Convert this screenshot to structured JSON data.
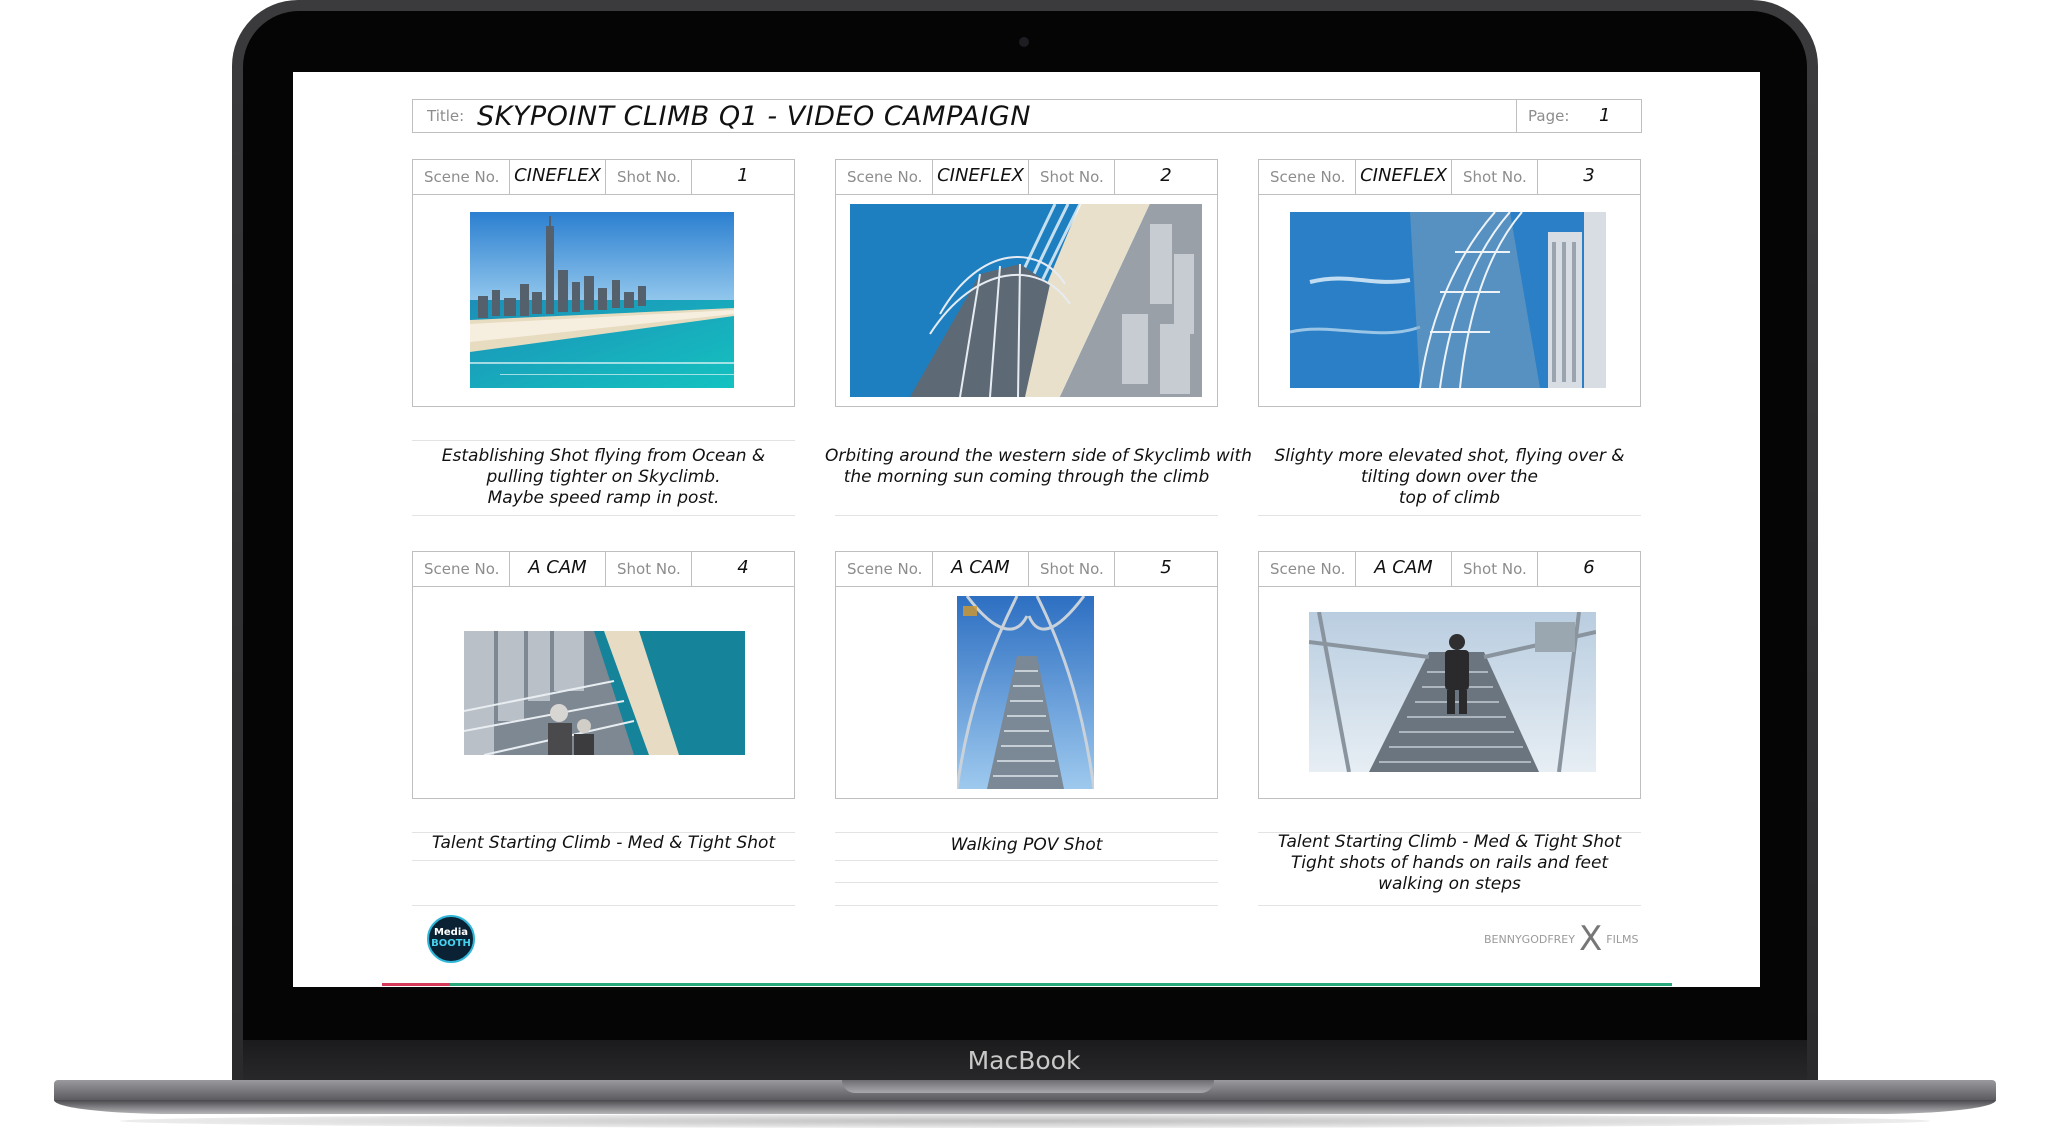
{
  "device": {
    "brand": "MacBook"
  },
  "storyboard": {
    "title_label": "Title:",
    "title": "SKYPOINT CLIMB Q1 - VIDEO CAMPAIGN",
    "page_label": "Page:",
    "page": "1"
  },
  "panels": [
    {
      "scene_label": "Scene No.",
      "scene": "CINEFLEX",
      "shot_label": "Shot No.",
      "shot": "1",
      "caption": [
        "Establishing Shot flying from Ocean &",
        "pulling tighter on Skyclimb.",
        "Maybe speed ramp in post."
      ]
    },
    {
      "scene_label": "Scene No.",
      "scene": "CINEFLEX",
      "shot_label": "Shot No.",
      "shot": "2",
      "caption": [
        "Orbiting around the western side of Skyclimb with",
        "the morning sun coming through the climb"
      ]
    },
    {
      "scene_label": "Scene No.",
      "scene": "CINEFLEX",
      "shot_label": "Shot No.",
      "shot": "3",
      "caption": [
        "Slighty more elevated shot, flying over &",
        "tilting down over the",
        "top of climb"
      ]
    },
    {
      "scene_label": "Scene No.",
      "scene": "A CAM",
      "shot_label": "Shot No.",
      "shot": "4",
      "caption": [
        "Talent Starting Climb -  Med & Tight Shot"
      ]
    },
    {
      "scene_label": "Scene No.",
      "scene": "A CAM",
      "shot_label": "Shot No.",
      "shot": "5",
      "caption": [
        "Walking POV Shot"
      ]
    },
    {
      "scene_label": "Scene No.",
      "scene": "A CAM",
      "shot_label": "Shot No.",
      "shot": "6",
      "caption": [
        "Talent Starting Climb -  Med & Tight Shot",
        "Tight shots of hands on rails and feet",
        "walking on steps"
      ]
    }
  ],
  "footer": {
    "left_logo": [
      "Media",
      "BOOTH"
    ],
    "right_logo": [
      "BENNYGODFREY",
      "X",
      "FILMS"
    ]
  }
}
